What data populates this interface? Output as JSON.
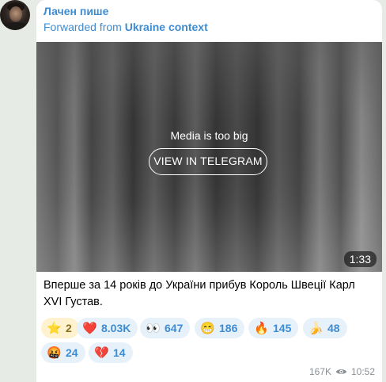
{
  "channel": {
    "name": "Лачен пише"
  },
  "forward": {
    "prefix": "Forwarded from",
    "source": "Ukraine context"
  },
  "media": {
    "message": "Media is too big",
    "button_label": "VIEW IN TELEGRAM",
    "duration": "1:33"
  },
  "post": {
    "text": "Вперше за 14 років до України прибув Король Швеції Карл XVI Густав."
  },
  "reactions": [
    {
      "icon": "star-icon",
      "glyph": "⭐",
      "count": "2"
    },
    {
      "icon": "red-heart-icon",
      "glyph": "❤️",
      "count": "8.03K"
    },
    {
      "icon": "eyes-icon",
      "glyph": "👀",
      "count": "647"
    },
    {
      "icon": "grimacing-face-icon",
      "glyph": "😁",
      "count": "186"
    },
    {
      "icon": "fire-icon",
      "glyph": "🔥",
      "count": "145"
    },
    {
      "icon": "banana-icon",
      "glyph": "🍌",
      "count": "48"
    },
    {
      "icon": "angry-face-icon",
      "glyph": "🤬",
      "count": "24"
    },
    {
      "icon": "broken-heart-icon",
      "glyph": "💔",
      "count": "14"
    }
  ],
  "footer": {
    "views": "167K",
    "time": "10:52"
  },
  "colors": {
    "accent": "#3e8cd1",
    "reaction_bg": "#e7f1fa",
    "star_bg": "#fff3cf",
    "background": "#e7ebe5"
  }
}
